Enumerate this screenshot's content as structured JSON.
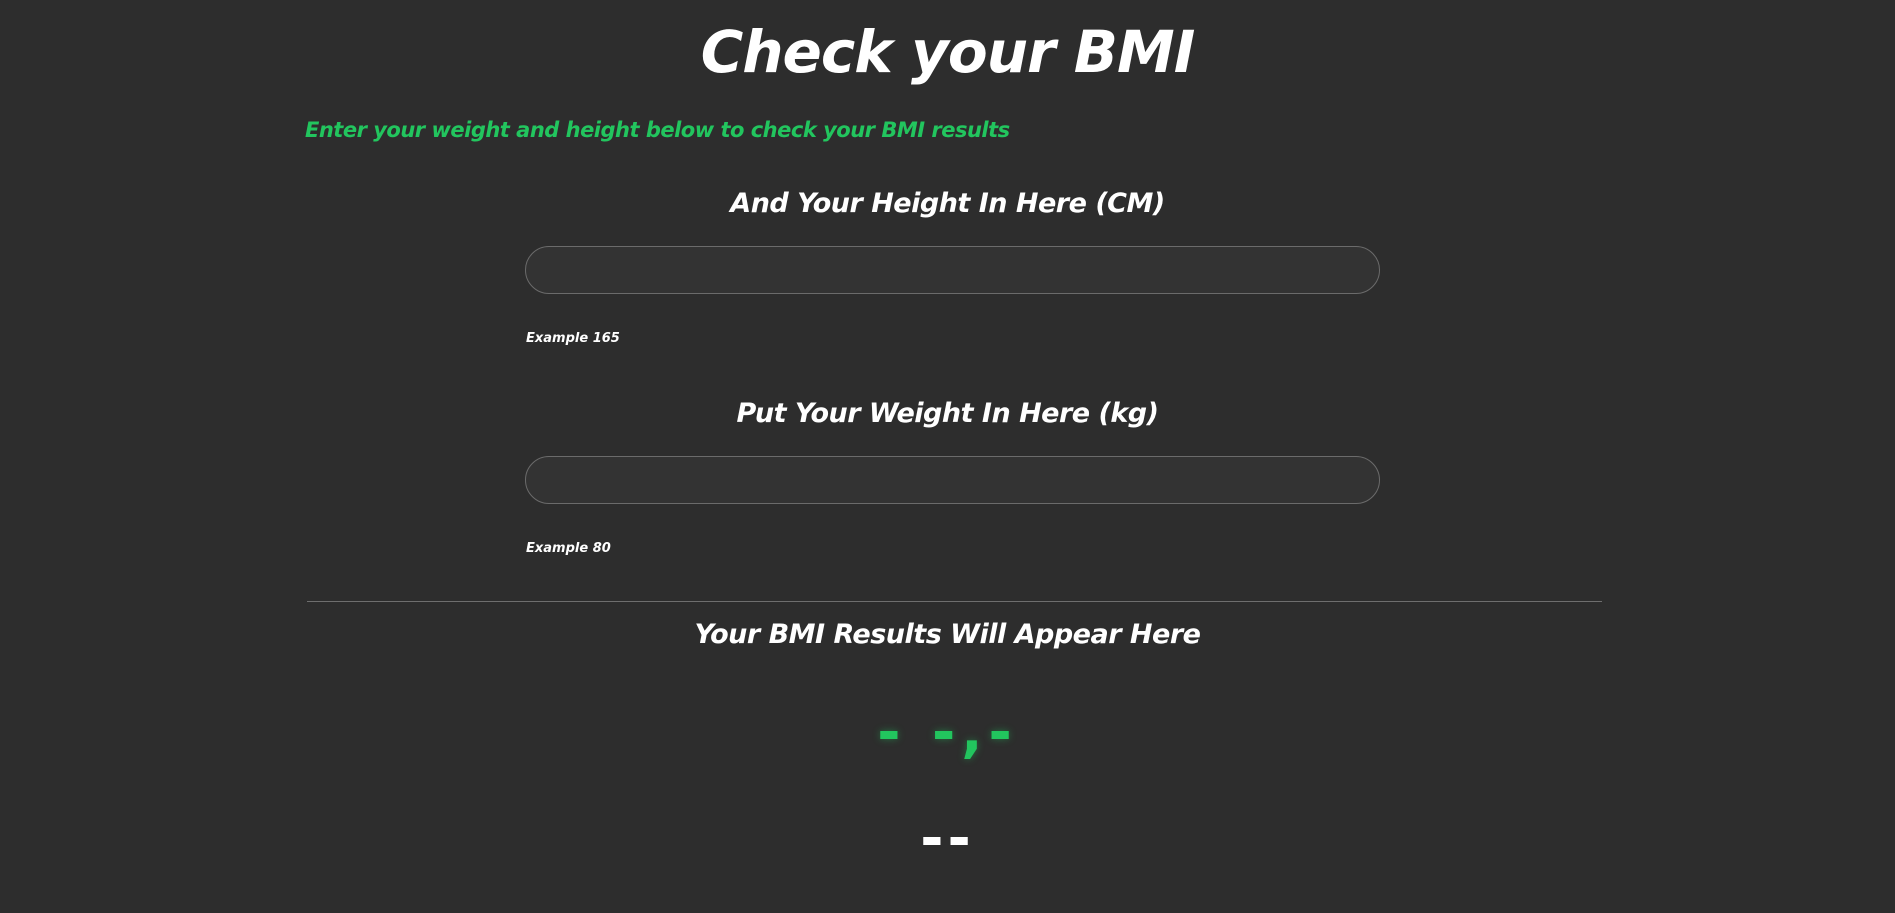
{
  "title": "Check your BMI",
  "subtitle": "Enter your weight and height below to check your BMI results",
  "height_field": {
    "label": "And Your Height In Here (CM)",
    "value": "",
    "hint": "Example 165"
  },
  "weight_field": {
    "label": "Put Your Weight In Here (kg)",
    "value": "",
    "hint": "Example 80"
  },
  "results": {
    "heading": "Your BMI Results Will Appear Here",
    "bmi_value": "- -,-",
    "category": "--"
  },
  "colors": {
    "background": "#2d2d2d",
    "accent": "#22c55e",
    "text": "#ffffff"
  }
}
